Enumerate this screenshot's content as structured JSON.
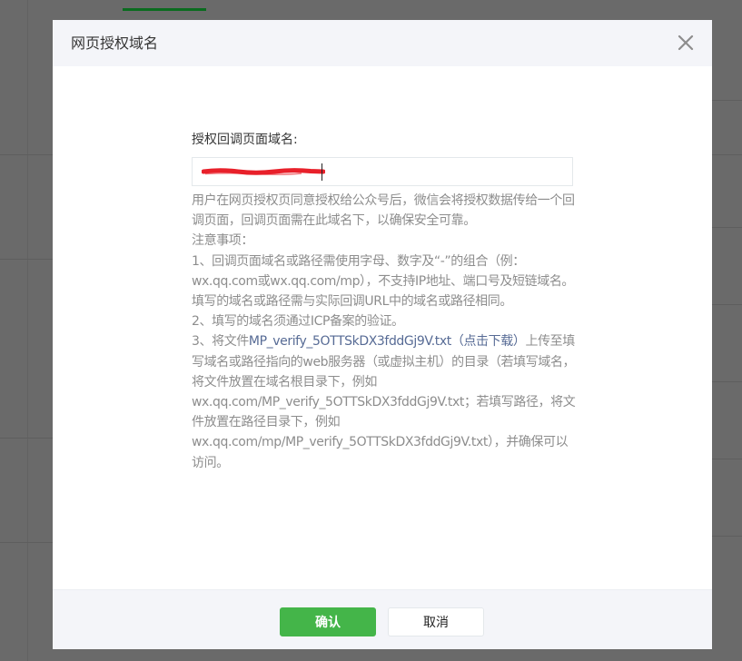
{
  "dialog": {
    "title": "网页授权域名",
    "close_icon": "close-icon"
  },
  "form": {
    "label": "授权回调页面域名:",
    "input_value": "",
    "input_redacted": true
  },
  "help": {
    "intro": "用户在网页授权页同意授权给公众号后，微信会将授权数据传给一个回调页面，回调页面需在此域名下，以确保安全可靠。",
    "notice_title": "注意事项：",
    "rule1": "1、回调页面域名或路径需使用字母、数字及“-”的组合（例：wx.qq.com或wx.qq.com/mp），不支持IP地址、端口号及短链域名。填写的域名或路径需与实际回调URL中的域名或路径相同。",
    "rule2": "2、填写的域名须通过ICP备案的验证。",
    "rule3_prefix": "3、将文件",
    "rule3_file": "MP_verify_5OTTSkDX3fddGj9V.txt",
    "rule3_download": "（点击下载）",
    "rule3_suffix": "上传至填写域名或路径指向的web服务器（或虚拟主机）的目录（若填写域名，将文件放置在域名根目录下，例如wx.qq.com/MP_verify_5OTTSkDX3fddGj9V.txt；若填写路径，将文件放置在路径目录下，例如wx.qq.com/mp/MP_verify_5OTTSkDX3fddGj9V.txt），并确保可以访问。"
  },
  "footer": {
    "confirm_label": "确认",
    "cancel_label": "取消"
  },
  "colors": {
    "primary": "#44b549",
    "link": "#576b95",
    "redaction": "#e8202a"
  }
}
